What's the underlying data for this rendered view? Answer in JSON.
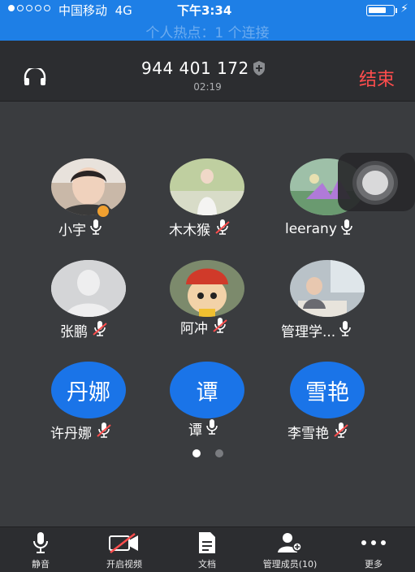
{
  "status_bar": {
    "carrier": "中国移动",
    "network": "4G",
    "time": "下午3:34",
    "battery_level": 0.75,
    "hotspot": "个人热点：1 个连接"
  },
  "call": {
    "meeting_id": "944 401 172",
    "duration": "02:19",
    "end_label": "结束"
  },
  "participants": [
    {
      "name": "小宇",
      "mic": "on",
      "host": true
    },
    {
      "name": "木木猴",
      "mic": "muted"
    },
    {
      "name": "leerany",
      "mic": "on"
    },
    {
      "name": "张鹏",
      "mic": "muted"
    },
    {
      "name": "阿冲",
      "mic": "muted"
    },
    {
      "name": "管理学...",
      "mic": "on"
    },
    {
      "name": "许丹娜",
      "mic": "muted",
      "avatar_text": "丹娜"
    },
    {
      "name": "谭",
      "mic": "on",
      "avatar_text": "谭"
    },
    {
      "name": "李雪艳",
      "mic": "muted",
      "avatar_text": "雪艳"
    }
  ],
  "pagination": {
    "pages": 2,
    "current": 1
  },
  "toolbar": {
    "mute": "静音",
    "video": "开启视频",
    "docs": "文档",
    "members": "管理成员(10)",
    "more": "更多"
  },
  "colors": {
    "accent": "#1e7fe6",
    "end": "#ff4d4d",
    "avatar_blue": "#1a74e8"
  }
}
